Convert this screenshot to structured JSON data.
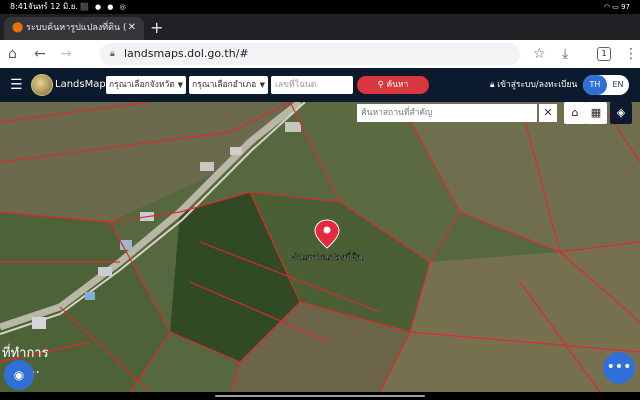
{
  "status_bar": {
    "time": "8:41",
    "date": "จันทร์ 12 มิ.ย.",
    "battery": "97"
  },
  "browser": {
    "tab_title": "ระบบค้นหารูปแปลงที่ดิน (Lands",
    "url": "landsmaps.dol.go.th/#",
    "tab_count": "1"
  },
  "app_header": {
    "brand": "LandsMaps",
    "province_placeholder": "กรุณาเลือกจังหวัด",
    "district_placeholder": "กรุณาเลือกอำเภอ",
    "parcel_placeholder": "เลขที่โฉนด",
    "search_label": "ค้นหา",
    "login_label": "เข้าสู่ระบบ/ลงทะเบียน",
    "lang_th": "TH",
    "lang_en": "EN"
  },
  "map": {
    "place_search_placeholder": "ค้นหาสถานที่สำคัญ",
    "marker_label": "ตำแหน่งแปลงที่ดิน",
    "place_text": "ที่ทำการ",
    "place_text2": "ซุม...",
    "boundary_color": "#e0282e",
    "marker_color": "#e8283c"
  }
}
